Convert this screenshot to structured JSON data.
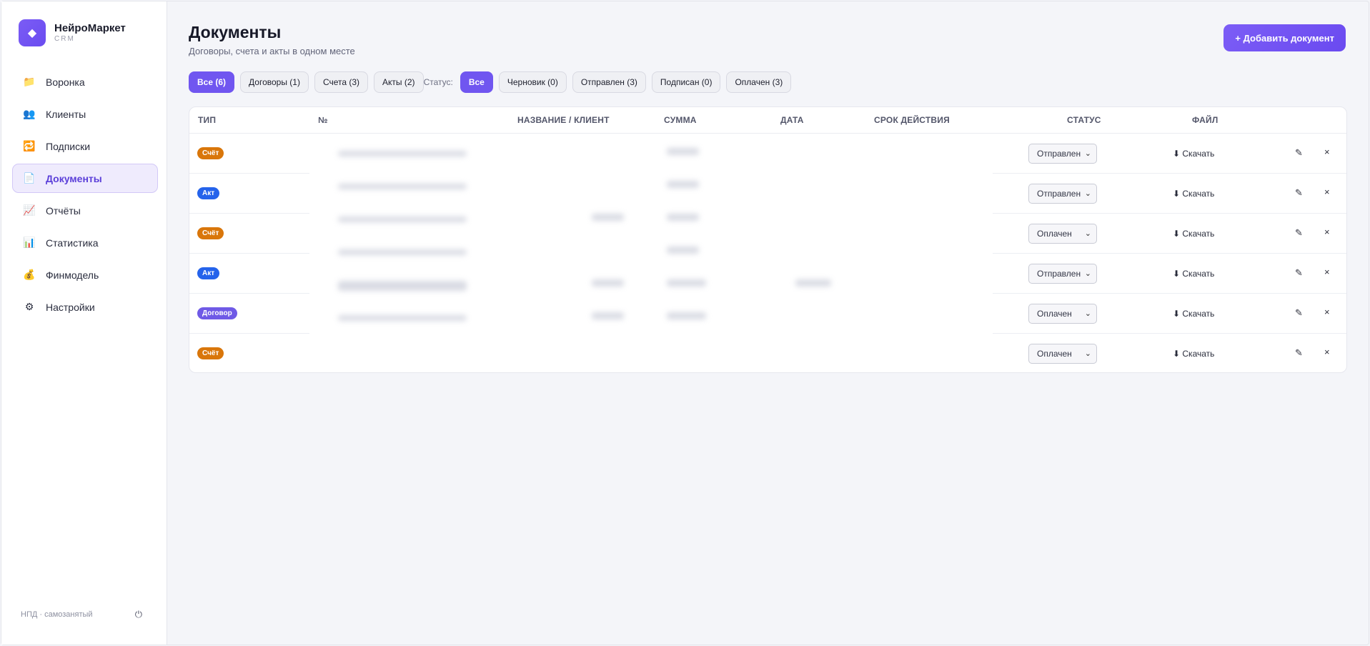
{
  "brand": {
    "name": "НейроМаркет",
    "sub": "CRM",
    "logo_icon": "diamond-icon"
  },
  "nav": [
    {
      "label": "Воронка",
      "icon": "📁",
      "name": "sidebar-item-funnel"
    },
    {
      "label": "Клиенты",
      "icon": "👥",
      "name": "sidebar-item-clients"
    },
    {
      "label": "Подписки",
      "icon": "🔁",
      "name": "sidebar-item-subscriptions"
    },
    {
      "label": "Документы",
      "icon": "📄",
      "name": "sidebar-item-documents",
      "active": true
    },
    {
      "label": "Отчёты",
      "icon": "📈",
      "name": "sidebar-item-reports"
    },
    {
      "label": "Статистика",
      "icon": "📊",
      "name": "sidebar-item-statistics"
    },
    {
      "label": "Финмодель",
      "icon": "💰",
      "name": "sidebar-item-finmodel"
    },
    {
      "label": "Настройки",
      "icon": "⚙",
      "name": "sidebar-item-settings"
    }
  ],
  "footer": {
    "text": "НПД · самозанятый",
    "power_icon": "⏻"
  },
  "page": {
    "title": "Документы",
    "subtitle": "Договоры, счета и акты в одном месте",
    "add_button": "+ Добавить документ"
  },
  "type_filters": [
    "Все (6)",
    "Договоры (1)",
    "Счета (3)",
    "Акты (2)"
  ],
  "status_label": "Статус:",
  "status_filters": [
    "Все",
    "Черновик (0)",
    "Отправлен (3)",
    "Подписан (0)",
    "Оплачен (3)"
  ],
  "columns": {
    "type": "ТИП",
    "number": "№",
    "name": "НАЗВАНИЕ / КЛИЕНТ",
    "sum": "СУММА",
    "date": "ДАТА",
    "validity": "СРОК ДЕЙСТВИЯ",
    "status": "СТАТУС",
    "file": "ФАЙЛ"
  },
  "rows": [
    {
      "type": "Счёт",
      "kind": "invoice",
      "status": "Отправлен",
      "download": "⬇ Скачать"
    },
    {
      "type": "Акт",
      "kind": "act",
      "status": "Отправлен",
      "download": "⬇ Скачать"
    },
    {
      "type": "Счёт",
      "kind": "invoice",
      "status": "Оплачен",
      "download": "⬇ Скачать"
    },
    {
      "type": "Акт",
      "kind": "act",
      "status": "Отправлен",
      "download": "⬇ Скачать"
    },
    {
      "type": "Договор",
      "kind": "contract",
      "status": "Оплачен",
      "download": "⬇ Скачать"
    },
    {
      "type": "Счёт",
      "kind": "invoice",
      "status": "Оплачен",
      "download": "⬇ Скачать"
    }
  ],
  "icons": {
    "edit": "✎",
    "delete": "×",
    "caret": "⌄"
  },
  "colors": {
    "accent": "#7056f0",
    "invoice": "#d9760a",
    "act": "#2563eb",
    "contract": "#6f5ae6"
  }
}
